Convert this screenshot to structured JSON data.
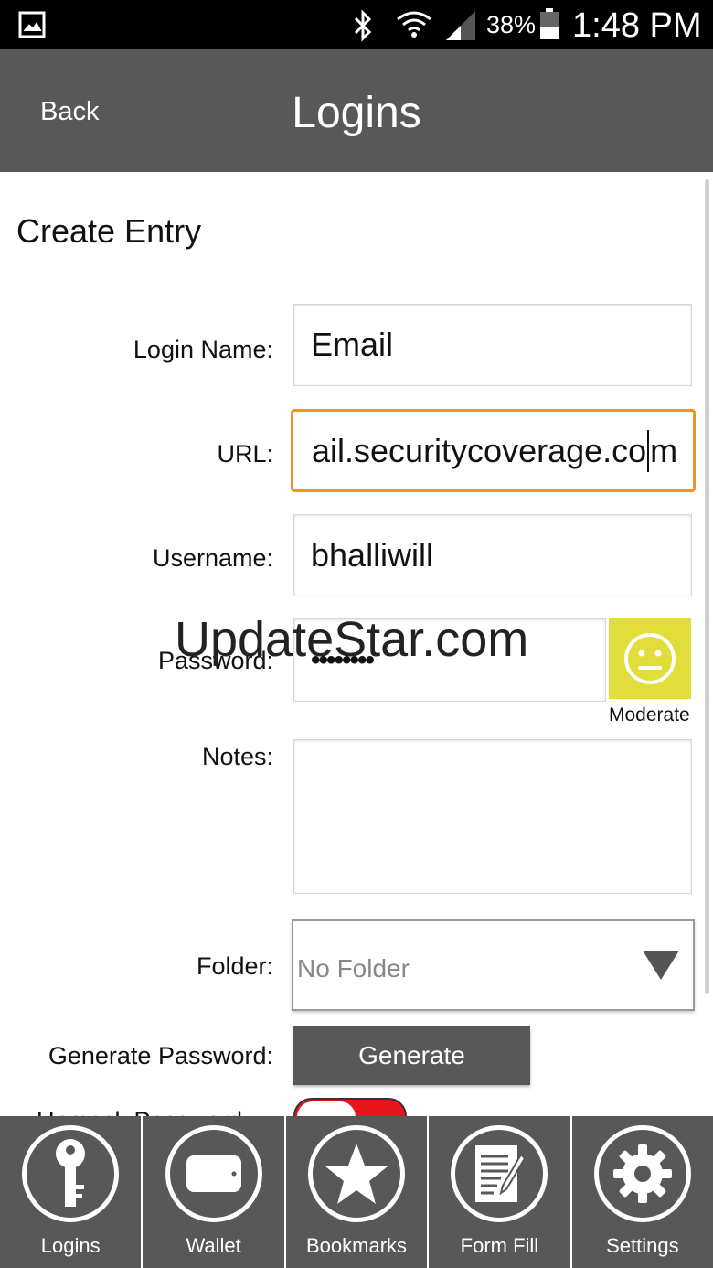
{
  "status_bar": {
    "battery": "38%",
    "time": "1:48 PM",
    "icons": [
      "image-icon",
      "bluetooth-icon",
      "wifi-icon",
      "signal-icon",
      "battery-icon"
    ]
  },
  "header": {
    "back_label": "Back",
    "title": "Logins"
  },
  "form": {
    "section_title": "Create Entry",
    "login_name": {
      "label": "Login Name:",
      "value": "Email"
    },
    "url": {
      "label": "URL:",
      "value_before_caret": "ail.securitycoverage.co",
      "value_after_caret": "m"
    },
    "username": {
      "label": "Username:",
      "value": "bhalliwill"
    },
    "password": {
      "label": "Password:",
      "value": "••••••••",
      "strength": "Moderate",
      "strength_color": "#e1dd3b"
    },
    "notes": {
      "label": "Notes:",
      "value": ""
    },
    "folder": {
      "label": "Folder:",
      "value": "No Folder"
    },
    "generate": {
      "label": "Generate Password:",
      "button": "Generate"
    },
    "partial_label": "Unmask Password:",
    "toggle_color": "#e8161b"
  },
  "watermark": "UpdateStar.com",
  "bottom_nav": [
    {
      "label": "Logins",
      "icon": "key-icon"
    },
    {
      "label": "Wallet",
      "icon": "wallet-icon"
    },
    {
      "label": "Bookmarks",
      "icon": "star-icon"
    },
    {
      "label": "Form Fill",
      "icon": "form-icon"
    },
    {
      "label": "Settings",
      "icon": "gear-icon"
    }
  ],
  "colors": {
    "header_bg": "#585858",
    "focus_border": "#f0922a"
  }
}
